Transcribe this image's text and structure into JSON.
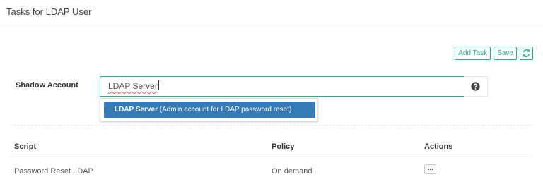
{
  "header": {
    "title": "Tasks for LDAP User"
  },
  "toolbar": {
    "add_task_label": "Add Task",
    "save_label": "Save",
    "refresh_icon": "refresh-icon"
  },
  "shadow_account": {
    "label": "Shadow Account",
    "input_value": "LDAP Server",
    "help_icon": "question-circle-icon"
  },
  "autocomplete": {
    "options": [
      {
        "name": "LDAP Server",
        "description": "(Admin account for LDAP password reset)"
      }
    ]
  },
  "table": {
    "headers": {
      "script": "Script",
      "policy": "Policy",
      "actions": "Actions"
    },
    "rows": [
      {
        "script": "Password Reset LDAP",
        "policy": "On demand",
        "actions_icon": "ellipsis-icon"
      }
    ]
  },
  "colors": {
    "accent": "#1ab394",
    "selected": "#337ab7"
  }
}
